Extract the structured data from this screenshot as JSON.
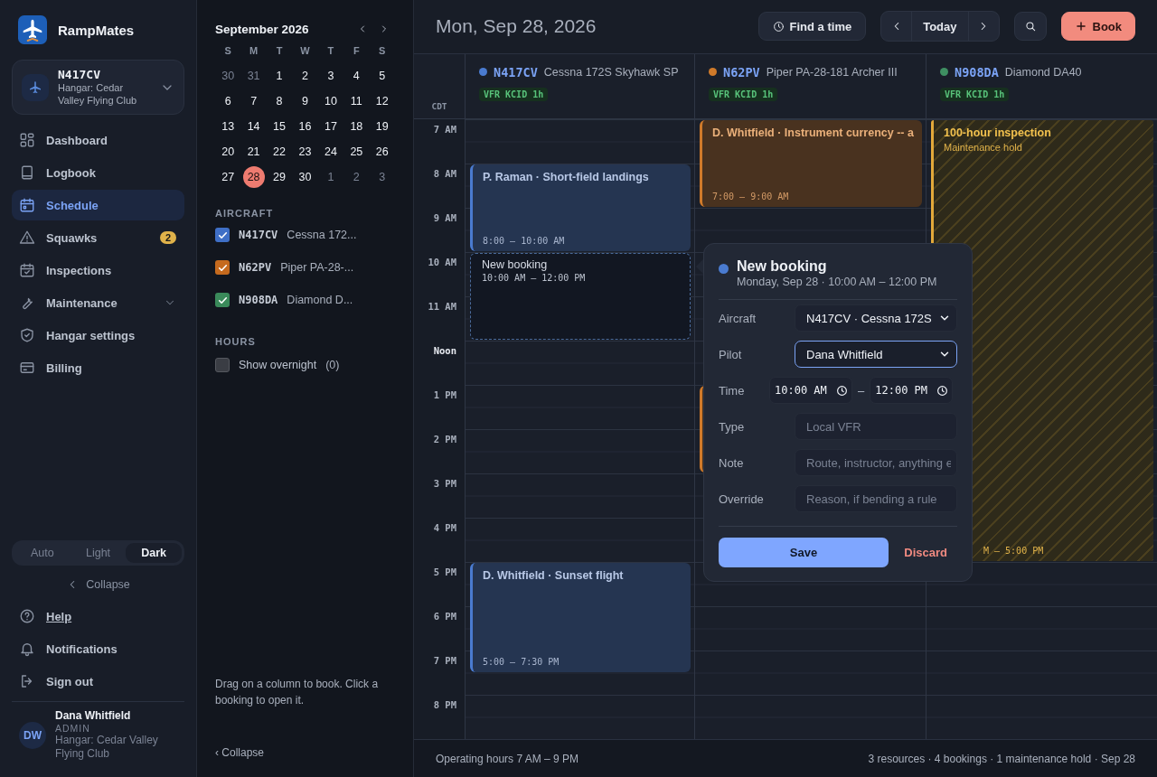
{
  "brand": {
    "name": "RampMates"
  },
  "aircraft_switcher": {
    "tail": "N417CV",
    "hangar": "Hangar: Cedar Valley Flying Club"
  },
  "nav": [
    {
      "label": "Dashboard",
      "selected": false
    },
    {
      "label": "Logbook",
      "selected": false
    },
    {
      "label": "Schedule",
      "selected": true
    },
    {
      "label": "Squawks",
      "selected": false,
      "badge": "2"
    },
    {
      "label": "Inspections",
      "selected": false
    },
    {
      "label": "Maintenance",
      "selected": false,
      "expandable": true
    },
    {
      "label": "Hangar settings",
      "selected": false
    },
    {
      "label": "Billing",
      "selected": false
    }
  ],
  "theme": [
    {
      "label": "Auto",
      "selected": false
    },
    {
      "label": "Light",
      "selected": false
    },
    {
      "label": "Dark",
      "selected": true
    }
  ],
  "sidebar_collapse": "Collapse",
  "footer_links": [
    {
      "label": "Help",
      "underlined": true
    },
    {
      "label": "Notifications",
      "underlined": false
    },
    {
      "label": "Sign out",
      "underlined": false
    }
  ],
  "user": {
    "initials": "DW",
    "name": "Dana Whitfield",
    "role": "ADMIN",
    "hangar": "Hangar: Cedar Valley Flying Club"
  },
  "mini_calendar": {
    "title": "September 2026",
    "weekdays": [
      "S",
      "M",
      "T",
      "W",
      "T",
      "F",
      "S"
    ],
    "days": [
      {
        "day": "30",
        "outside": true,
        "selected": false
      },
      {
        "day": "31",
        "outside": true,
        "selected": false
      },
      {
        "day": "1",
        "outside": false,
        "selected": false
      },
      {
        "day": "2",
        "outside": false,
        "selected": false
      },
      {
        "day": "3",
        "outside": false,
        "selected": false
      },
      {
        "day": "4",
        "outside": false,
        "selected": false
      },
      {
        "day": "5",
        "outside": false,
        "selected": false
      },
      {
        "day": "6",
        "outside": false,
        "selected": false
      },
      {
        "day": "7",
        "outside": false,
        "selected": false
      },
      {
        "day": "8",
        "outside": false,
        "selected": false
      },
      {
        "day": "9",
        "outside": false,
        "selected": false
      },
      {
        "day": "10",
        "outside": false,
        "selected": false
      },
      {
        "day": "11",
        "outside": false,
        "selected": false
      },
      {
        "day": "12",
        "outside": false,
        "selected": false
      },
      {
        "day": "13",
        "outside": false,
        "selected": false
      },
      {
        "day": "14",
        "outside": false,
        "selected": false
      },
      {
        "day": "15",
        "outside": false,
        "selected": false
      },
      {
        "day": "16",
        "outside": false,
        "selected": false
      },
      {
        "day": "17",
        "outside": false,
        "selected": false
      },
      {
        "day": "18",
        "outside": false,
        "selected": false
      },
      {
        "day": "19",
        "outside": false,
        "selected": false
      },
      {
        "day": "20",
        "outside": false,
        "selected": false
      },
      {
        "day": "21",
        "outside": false,
        "selected": false
      },
      {
        "day": "22",
        "outside": false,
        "selected": false
      },
      {
        "day": "23",
        "outside": false,
        "selected": false
      },
      {
        "day": "24",
        "outside": false,
        "selected": false
      },
      {
        "day": "25",
        "outside": false,
        "selected": false
      },
      {
        "day": "26",
        "outside": false,
        "selected": false
      },
      {
        "day": "27",
        "outside": false,
        "selected": false
      },
      {
        "day": "28",
        "outside": false,
        "selected": true
      },
      {
        "day": "29",
        "outside": false,
        "selected": false
      },
      {
        "day": "30",
        "outside": false,
        "selected": false
      },
      {
        "day": "1",
        "outside": true,
        "selected": false
      },
      {
        "day": "2",
        "outside": true,
        "selected": false
      },
      {
        "day": "3",
        "outside": true,
        "selected": false
      }
    ]
  },
  "aircraft_filter": {
    "heading": "AIRCRAFT",
    "items": [
      {
        "tail": "N417CV",
        "model": "Cessna 172...",
        "checked": true,
        "color": "#3f6fc6"
      },
      {
        "tail": "N62PV",
        "model": "Piper PA-28-...",
        "checked": true,
        "color": "#c56a1e"
      },
      {
        "tail": "N908DA",
        "model": "Diamond D...",
        "checked": true,
        "color": "#3a8a5a"
      }
    ]
  },
  "hours_filter": {
    "heading": "HOURS",
    "label": "Show overnight",
    "count": "(0)",
    "checked": false
  },
  "hint": "Drag on a column to book. Click a booking to open it.",
  "panel_collapse": "‹ Collapse",
  "toolbar": {
    "date": "Mon, Sep 28, 2026",
    "find": "Find a time",
    "today": "Today",
    "book": "Book"
  },
  "timezone": "CDT",
  "hour_labels": [
    "7 AM",
    "8 AM",
    "9 AM",
    "10 AM",
    "11 AM",
    "Noon",
    "1 PM",
    "2 PM",
    "3 PM",
    "4 PM",
    "5 PM",
    "6 PM",
    "7 PM",
    "8 PM"
  ],
  "resources": [
    {
      "tail": "N417CV",
      "model": "Cessna 172S Skyhawk SP",
      "color": "#4a7bd0",
      "weather": "VFR KCID 1h",
      "events": [
        {
          "kind": "booking",
          "title": "P. Raman · Short-field landings",
          "time": "8:00 – 10:00 AM"
        },
        {
          "kind": "draft",
          "title": "New booking",
          "time": "10:00 AM – 12:00 PM"
        },
        {
          "kind": "booking",
          "title": "D. Whitfield · Sunset flight",
          "time": "5:00 – 7:30 PM"
        }
      ]
    },
    {
      "tail": "N62PV",
      "model": "Piper PA-28-181 Archer III",
      "color": "#d07a2a",
      "weather": "VFR KCID 1h",
      "events": [
        {
          "kind": "booking",
          "title": "D. Whitfield · Instrument currency -- a",
          "time": "7:00 – 9:00 AM"
        },
        {
          "kind": "booking"
        }
      ]
    },
    {
      "tail": "N908DA",
      "model": "Diamond DA40",
      "color": "#3f8f62",
      "weather": "VFR KCID 1h",
      "events": [
        {
          "kind": "hold",
          "title": "100-hour inspection",
          "subtitle": "Maintenance hold",
          "time": "M – 5:00 PM"
        }
      ]
    }
  ],
  "popover": {
    "title": "New booking",
    "subtitle": "Monday, Sep 28 · 10:00 AM – 12:00 PM",
    "color": "#4a7bd0",
    "fields": [
      {
        "label": "Aircraft",
        "kind": "select",
        "value": "N417CV · Cessna 172S",
        "focused": false
      },
      {
        "label": "Pilot",
        "kind": "select",
        "value": "Dana Whitfield",
        "focused": true
      },
      {
        "label": "Time",
        "kind": "timerange",
        "from": "10:00 AM",
        "to": "12:00 PM",
        "separator": "–",
        "focused": false
      },
      {
        "label": "Type",
        "kind": "text",
        "placeholder": "Local VFR",
        "focused": false
      },
      {
        "label": "Note",
        "kind": "text",
        "placeholder": "Route, instructor, anything e",
        "focused": false
      },
      {
        "label": "Override",
        "kind": "text",
        "placeholder": "Reason, if bending a rule",
        "focused": false
      }
    ],
    "save": "Save",
    "discard": "Discard"
  },
  "status_bar": {
    "left": "Operating hours 7 AM – 9 PM",
    "right": "3 resources · 4 bookings · 1 maintenance hold · Sep 28"
  }
}
